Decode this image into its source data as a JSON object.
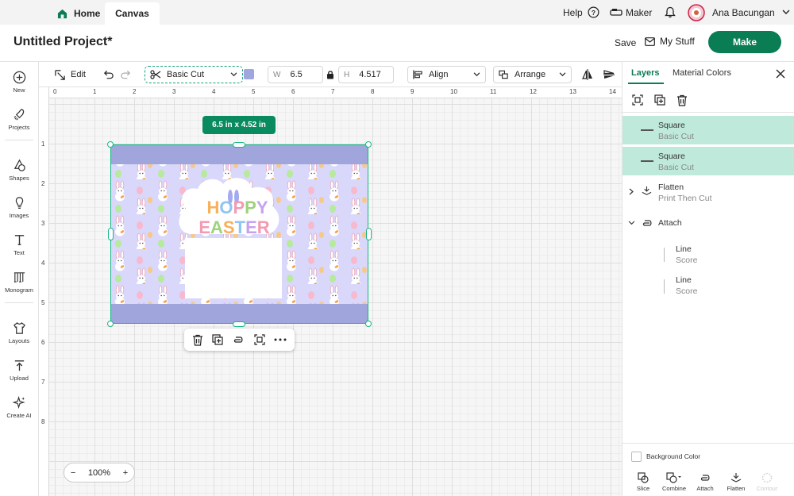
{
  "topbar": {
    "home_label": "Home",
    "canvas_label": "Canvas",
    "help_label": "Help",
    "machine_label": "Maker",
    "user_name": "Ana Bacungan"
  },
  "header": {
    "project_title": "Untitled Project*",
    "save_label": "Save",
    "mystuff_label": "My Stuff",
    "make_label": "Make"
  },
  "sidebar": {
    "items": [
      {
        "label": "New",
        "icon": "plus-circle-icon"
      },
      {
        "label": "Projects",
        "icon": "rocket-icon"
      },
      {
        "label": "Shapes",
        "icon": "shapes-icon"
      },
      {
        "label": "Images",
        "icon": "lightbulb-icon"
      },
      {
        "label": "Text",
        "icon": "text-icon"
      },
      {
        "label": "Monogram",
        "icon": "monogram-icon"
      },
      {
        "label": "Layouts",
        "icon": "shirt-icon"
      },
      {
        "label": "Upload",
        "icon": "upload-icon"
      },
      {
        "label": "Create AI",
        "icon": "sparkle-icon"
      }
    ]
  },
  "toolbar": {
    "edit_label": "Edit",
    "operation_label": "Basic Cut",
    "color": "#9fa7df",
    "width_label": "W",
    "width_value": "6.5",
    "height_label": "H",
    "height_value": "4.517",
    "align_label": "Align",
    "arrange_label": "Arrange"
  },
  "rulers": {
    "top": [
      "0",
      "1",
      "2",
      "3",
      "4",
      "5",
      "6",
      "7",
      "8",
      "9",
      "10",
      "11",
      "12",
      "13",
      "14"
    ],
    "left": [
      "1",
      "2",
      "3",
      "4",
      "5",
      "6",
      "7",
      "8"
    ]
  },
  "canvas": {
    "dimension_badge": "6.5  in x 4.52  in",
    "design_text_line1": "HOPPY",
    "design_text_line2": "EASTER",
    "band_color": "#a0a6db",
    "pattern_bg_color": "#d9d8fb",
    "zoom_value": "100%",
    "zoom_minus": "−",
    "zoom_plus": "+"
  },
  "panel": {
    "tab_layers": "Layers",
    "tab_material_colors": "Material Colors",
    "layers": [
      {
        "name": "Square",
        "operation": "Basic Cut",
        "selected": true
      },
      {
        "name": "Square",
        "operation": "Basic Cut",
        "selected": true
      },
      {
        "name": "Flatten",
        "operation": "Print Then Cut",
        "selected": false
      },
      {
        "name": "Attach",
        "operation": "",
        "selected": false
      },
      {
        "name": "Line",
        "operation": "Score",
        "selected": false
      },
      {
        "name": "Line",
        "operation": "Score",
        "selected": false
      }
    ],
    "background_color_label": "Background Color",
    "bottom_tools": [
      "Slice",
      "Combine",
      "Attach",
      "Flatten",
      "Contour"
    ]
  },
  "colors": {
    "accent": "#0a7d54",
    "selection": "#18b687",
    "selected_row": "#bfeadb"
  }
}
